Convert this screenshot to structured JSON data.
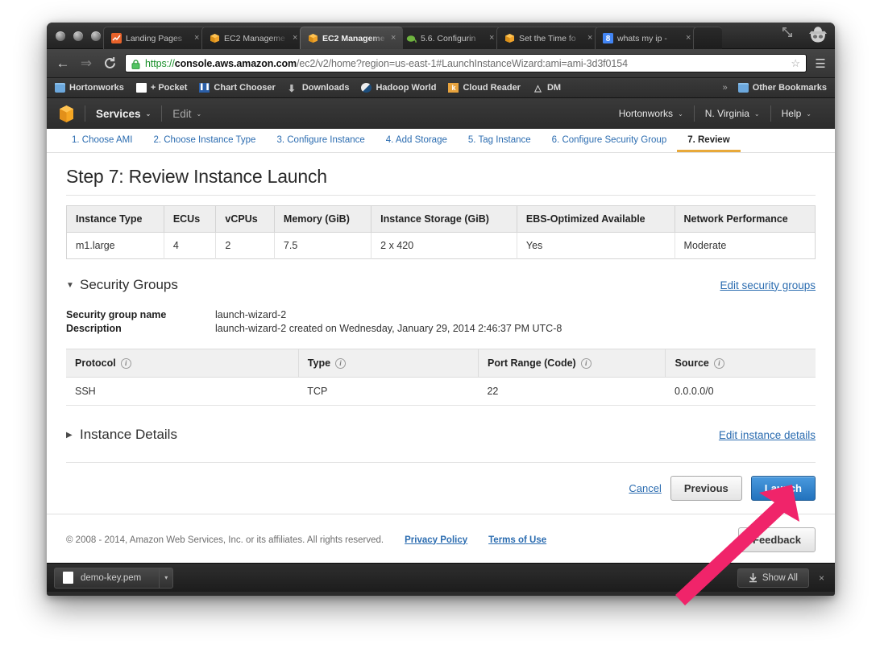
{
  "browser": {
    "tabs": [
      {
        "label": "Landing Pages",
        "favicon": "chart-favicon",
        "color": "#e8622a",
        "active": false
      },
      {
        "label": "EC2 Manageme",
        "favicon": "aws-cube-favicon",
        "color": "#f0a32b",
        "active": false
      },
      {
        "label": "EC2 Manageme",
        "favicon": "aws-cube-favicon",
        "color": "#f0a32b",
        "active": true
      },
      {
        "label": "5.6. Configurin",
        "favicon": "elephant-favicon",
        "color": "#6fb43f",
        "active": false
      },
      {
        "label": "Set the Time fo",
        "favicon": "aws-cube-favicon",
        "color": "#f0a32b",
        "active": false
      },
      {
        "label": "whats my ip -",
        "favicon": "google-favicon",
        "color": "#4285f4",
        "active": false
      }
    ],
    "tab_close_glyph": "×",
    "url": {
      "scheme": "https://",
      "host": "console.aws.amazon.com",
      "path": "/ec2/v2/home?region=us-east-1#LaunchInstanceWizard:ami=ami-3d3f0154"
    },
    "nav": {
      "back": "←",
      "forward": "⇒",
      "reload": "↻"
    },
    "star_glyph": "☆",
    "menu_glyph": "☰",
    "bookmarks": [
      {
        "label": "Hortonworks",
        "icon": "folder-icon"
      },
      {
        "label": "+ Pocket",
        "icon": "document-icon"
      },
      {
        "label": "Chart Chooser",
        "icon": "chart-chooser-icon"
      },
      {
        "label": "Downloads",
        "icon": "download-arrow-icon"
      },
      {
        "label": "Hadoop World",
        "icon": "hadoop-icon"
      },
      {
        "label": "Cloud Reader",
        "icon": "kindle-icon"
      },
      {
        "label": "DM",
        "icon": "triangle-icon"
      }
    ],
    "bookmarks_overflow": "»",
    "other_bookmarks": "Other Bookmarks"
  },
  "aws_header": {
    "logo": "aws-cube-logo",
    "left_menus": [
      "Services",
      "Edit"
    ],
    "right_menus": [
      "Hortonworks",
      "N. Virginia",
      "Help"
    ],
    "caret_glyph": "⌄"
  },
  "wizard": {
    "steps": [
      {
        "label": "1. Choose AMI",
        "active": false
      },
      {
        "label": "2. Choose Instance Type",
        "active": false
      },
      {
        "label": "3. Configure Instance",
        "active": false
      },
      {
        "label": "4. Add Storage",
        "active": false
      },
      {
        "label": "5. Tag Instance",
        "active": false
      },
      {
        "label": "6. Configure Security Group",
        "active": false
      },
      {
        "label": "7. Review",
        "active": true
      }
    ],
    "active_underline_color": "#e8a93a"
  },
  "page": {
    "title": "Step 7: Review Instance Launch",
    "instance_table": {
      "headers": [
        "Instance Type",
        "ECUs",
        "vCPUs",
        "Memory (GiB)",
        "Instance Storage (GiB)",
        "EBS-Optimized Available",
        "Network Performance"
      ],
      "rows": [
        [
          "m1.large",
          "4",
          "2",
          "7.5",
          "2 x 420",
          "Yes",
          "Moderate"
        ]
      ]
    },
    "security_groups": {
      "heading": "Security Groups",
      "twisty": "▼",
      "edit_link": "Edit security groups",
      "fields": [
        {
          "key": "Security group name",
          "value": "launch-wizard-2"
        },
        {
          "key": "Description",
          "value": "launch-wizard-2 created on Wednesday, January 29, 2014 2:46:37 PM UTC-8"
        }
      ],
      "rules_table": {
        "headers": [
          "Protocol",
          "Type",
          "Port Range (Code)",
          "Source"
        ],
        "info_glyph": "i",
        "rows": [
          [
            "SSH",
            "TCP",
            "22",
            "0.0.0.0/0"
          ]
        ]
      }
    },
    "instance_details": {
      "heading": "Instance Details",
      "twisty": "▶",
      "edit_link": "Edit instance details"
    },
    "actions": {
      "cancel": "Cancel",
      "previous": "Previous",
      "launch": "Launch",
      "launch_color": "#2272bd"
    },
    "footer": {
      "copyright": "© 2008 - 2014, Amazon Web Services, Inc. or its affiliates. All rights reserved.",
      "links": [
        "Privacy Policy",
        "Terms of Use"
      ],
      "feedback": "Feedback"
    }
  },
  "download_shelf": {
    "file_name": "demo-key.pem",
    "caret_glyph": "▾",
    "show_all": "Show All",
    "close_glyph": "×"
  },
  "annotation": {
    "arrow_color": "#f0246a",
    "points_to": "launch-button"
  }
}
